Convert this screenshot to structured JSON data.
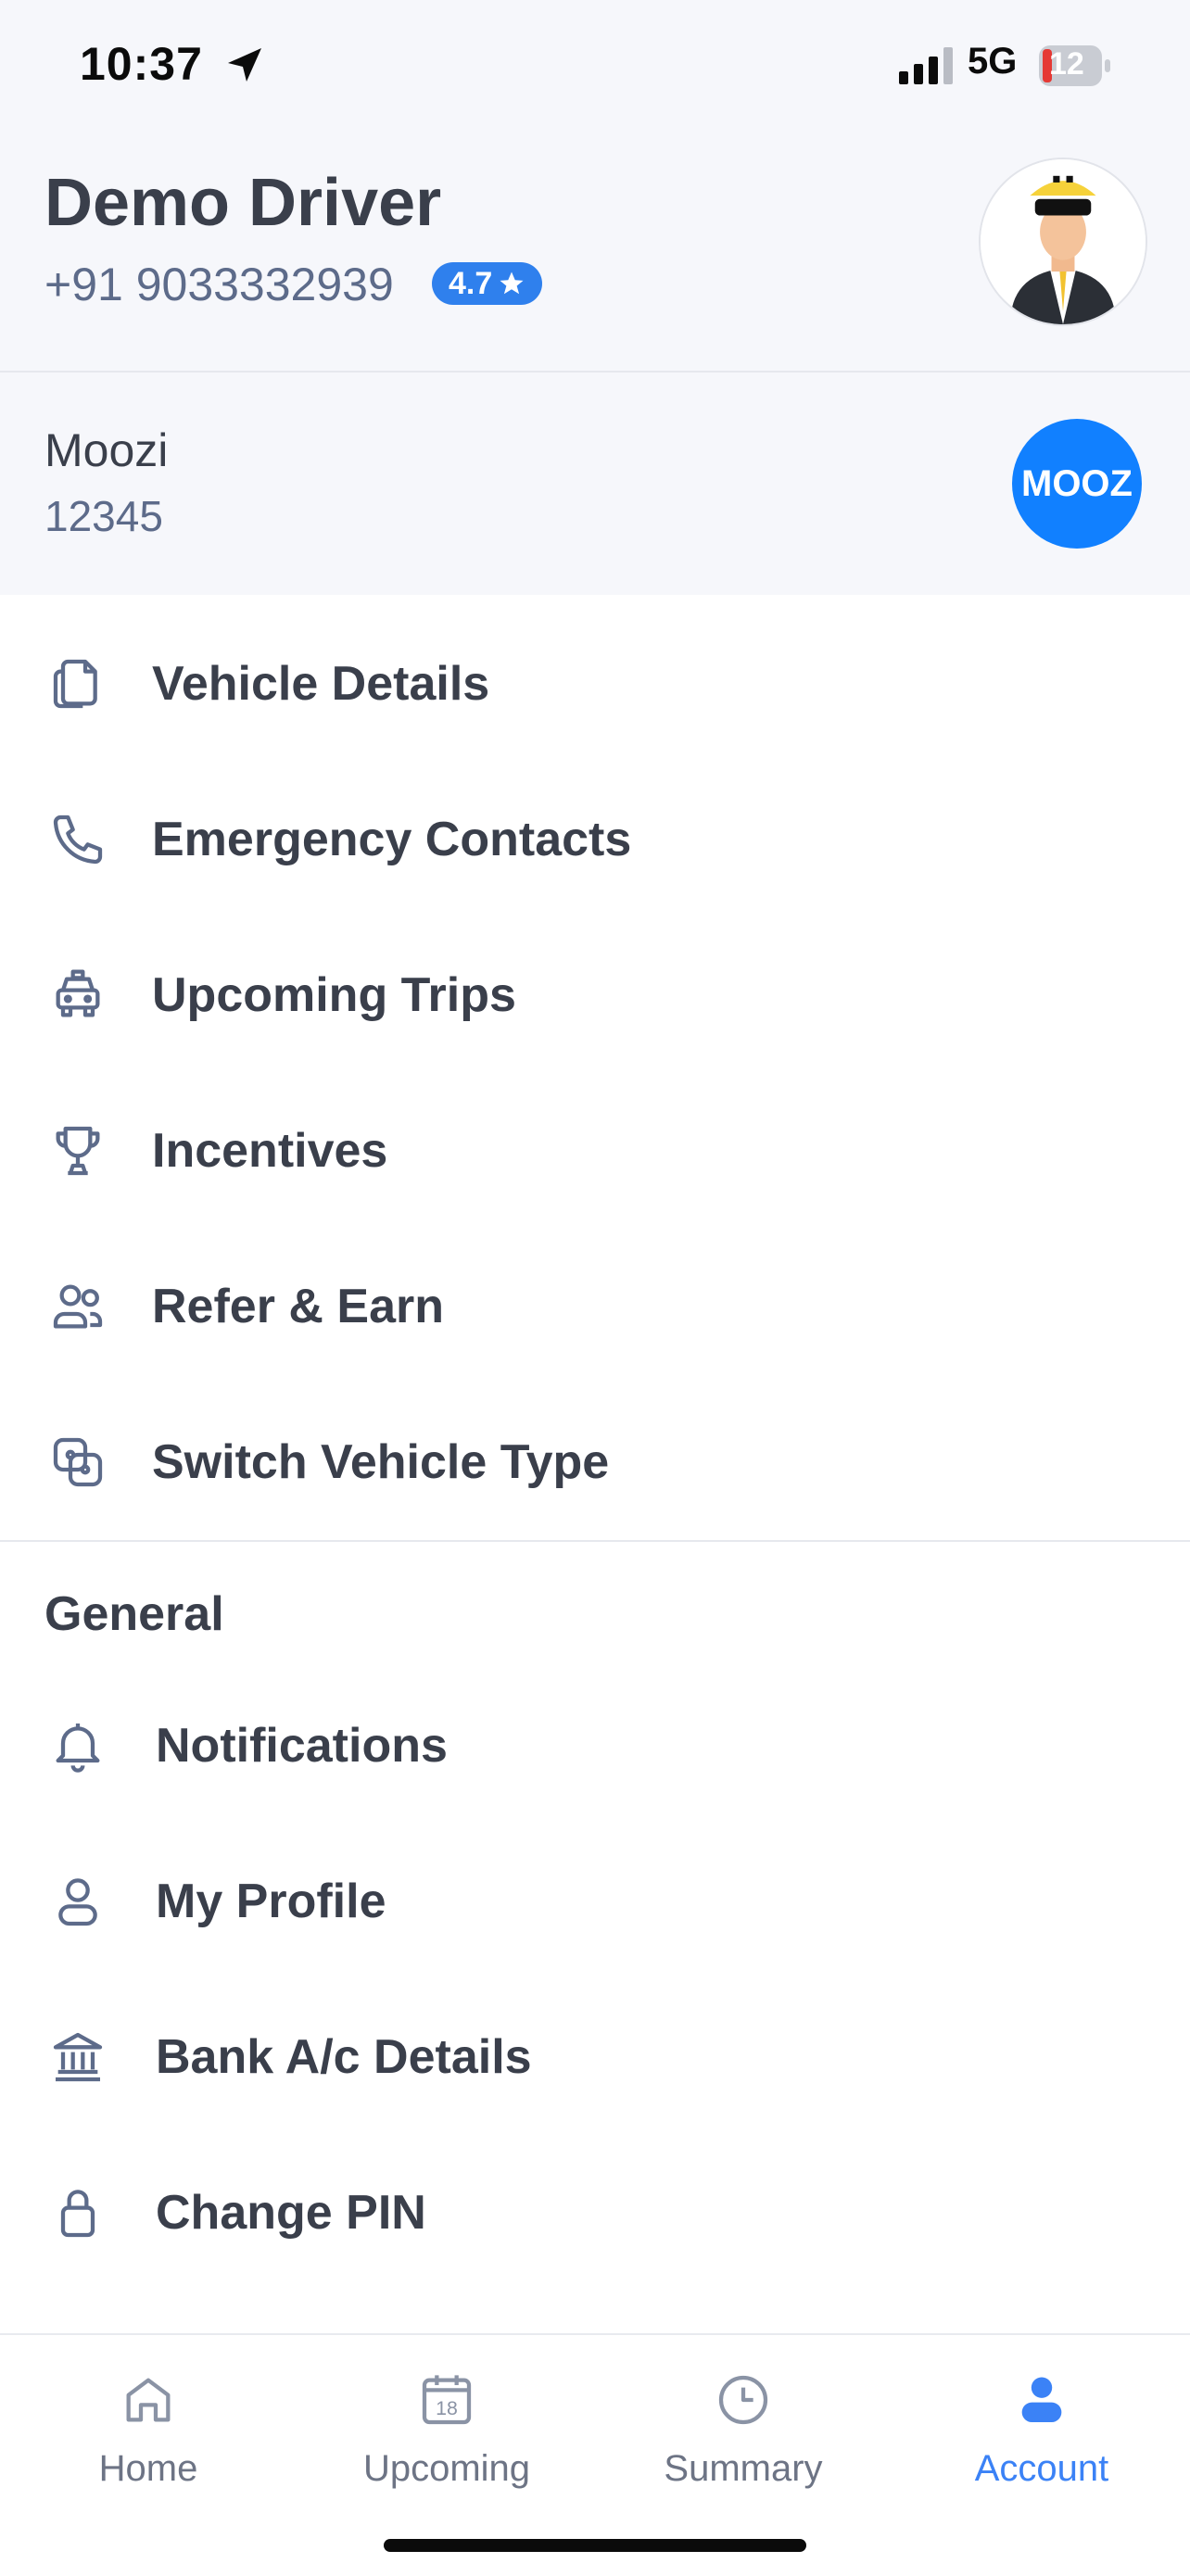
{
  "status_bar": {
    "time": "10:37",
    "network": "5G",
    "battery": "12"
  },
  "header": {
    "name": "Demo Driver",
    "phone": "+91 9033332939",
    "rating": "4.7"
  },
  "company": {
    "name": "Moozi",
    "code": "12345",
    "logo_text": "MOOZ"
  },
  "menu": [
    {
      "label": "Vehicle Details",
      "icon": "document-icon"
    },
    {
      "label": "Emergency Contacts",
      "icon": "phone-icon"
    },
    {
      "label": "Upcoming Trips",
      "icon": "taxi-icon"
    },
    {
      "label": "Incentives",
      "icon": "trophy-icon"
    },
    {
      "label": "Refer & Earn",
      "icon": "users-icon"
    },
    {
      "label": "Switch Vehicle Type",
      "icon": "switch-icon"
    }
  ],
  "general": {
    "title": "General",
    "items": [
      {
        "label": "Notifications",
        "icon": "bell-icon"
      },
      {
        "label": "My Profile",
        "icon": "user-icon"
      },
      {
        "label": "Bank A/c Details",
        "icon": "bank-icon"
      },
      {
        "label": "Change PIN",
        "icon": "lock-icon"
      }
    ]
  },
  "tabs": [
    {
      "label": "Home",
      "icon": "home-icon",
      "active": false
    },
    {
      "label": "Upcoming",
      "icon": "calendar-icon",
      "calendar_day": "18",
      "active": false
    },
    {
      "label": "Summary",
      "icon": "clock-icon",
      "active": false
    },
    {
      "label": "Account",
      "icon": "account-icon",
      "active": true
    }
  ],
  "colors": {
    "accent": "#3b82f6",
    "rating_badge": "#2f80ed",
    "company_logo": "#1180ff",
    "header_bg": "#f6f7fb",
    "text": "#3a3f4b",
    "icon": "#5d6b8a",
    "battery_low": "#e53935"
  }
}
